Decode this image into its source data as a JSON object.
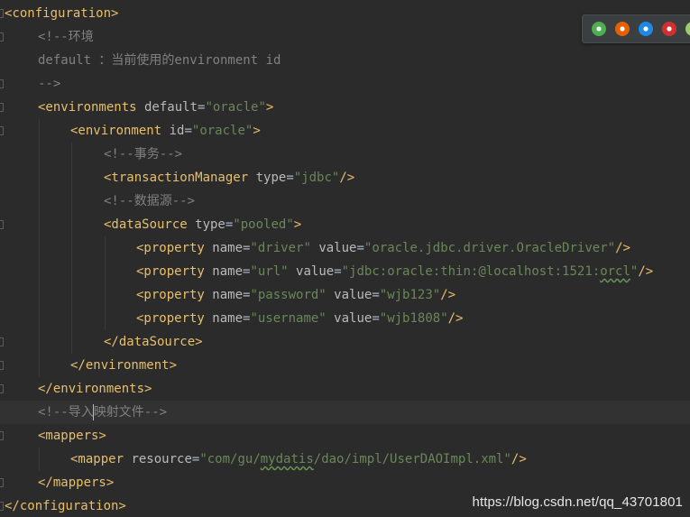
{
  "editor": {
    "lines": [
      [
        {
          "t": "<",
          "c": "tag"
        },
        {
          "t": "configuration",
          "c": "tag"
        },
        {
          "t": ">",
          "c": "tag"
        }
      ],
      [
        {
          "t": "<!--环境",
          "c": "cmt"
        }
      ],
      [
        {
          "t": "default ：当前使用的environment id",
          "c": "cmt"
        }
      ],
      [
        {
          "t": "-->",
          "c": "cmt"
        }
      ],
      [
        {
          "t": "<environments",
          "c": "tag"
        },
        {
          "t": " default",
          "c": "attr"
        },
        {
          "t": "=",
          "c": "txt"
        },
        {
          "t": "\"oracle\"",
          "c": "str"
        },
        {
          "t": ">",
          "c": "tag"
        }
      ],
      [
        {
          "t": "<environment",
          "c": "tag"
        },
        {
          "t": " id",
          "c": "attr"
        },
        {
          "t": "=",
          "c": "txt"
        },
        {
          "t": "\"oracle\"",
          "c": "str"
        },
        {
          "t": ">",
          "c": "tag"
        }
      ],
      [
        {
          "t": "<!--事务-->",
          "c": "cmt"
        }
      ],
      [
        {
          "t": "<transactionManager",
          "c": "tag"
        },
        {
          "t": " type",
          "c": "attr"
        },
        {
          "t": "=",
          "c": "txt"
        },
        {
          "t": "\"jdbc\"",
          "c": "str"
        },
        {
          "t": "/>",
          "c": "tag"
        }
      ],
      [
        {
          "t": "<!--数据源-->",
          "c": "cmt"
        }
      ],
      [
        {
          "t": "<dataSource",
          "c": "tag"
        },
        {
          "t": " type",
          "c": "attr"
        },
        {
          "t": "=",
          "c": "txt"
        },
        {
          "t": "\"pooled\"",
          "c": "str"
        },
        {
          "t": ">",
          "c": "tag"
        }
      ],
      [
        {
          "t": "<property",
          "c": "tag"
        },
        {
          "t": " name",
          "c": "attr"
        },
        {
          "t": "=",
          "c": "txt"
        },
        {
          "t": "\"driver\"",
          "c": "str"
        },
        {
          "t": " value",
          "c": "attr"
        },
        {
          "t": "=",
          "c": "txt"
        },
        {
          "t": "\"oracle.jdbc.driver.OracleDriver\"",
          "c": "str"
        },
        {
          "t": "/>",
          "c": "tag"
        }
      ],
      [
        {
          "t": "<property",
          "c": "tag"
        },
        {
          "t": " name",
          "c": "attr"
        },
        {
          "t": "=",
          "c": "txt"
        },
        {
          "t": "\"url\"",
          "c": "str"
        },
        {
          "t": " value",
          "c": "attr"
        },
        {
          "t": "=",
          "c": "txt"
        },
        {
          "t": "\"jdbc:oracle:thin:@localhost:1521:",
          "c": "str"
        },
        {
          "t": "orcl",
          "c": "str typo"
        },
        {
          "t": "\"",
          "c": "str"
        },
        {
          "t": "/>",
          "c": "tag"
        }
      ],
      [
        {
          "t": "<property",
          "c": "tag"
        },
        {
          "t": " name",
          "c": "attr"
        },
        {
          "t": "=",
          "c": "txt"
        },
        {
          "t": "\"password\"",
          "c": "str"
        },
        {
          "t": " value",
          "c": "attr"
        },
        {
          "t": "=",
          "c": "txt"
        },
        {
          "t": "\"wjb123\"",
          "c": "str"
        },
        {
          "t": "/>",
          "c": "tag"
        }
      ],
      [
        {
          "t": "<property",
          "c": "tag"
        },
        {
          "t": " name",
          "c": "attr"
        },
        {
          "t": "=",
          "c": "txt"
        },
        {
          "t": "\"username\"",
          "c": "str"
        },
        {
          "t": " value",
          "c": "attr"
        },
        {
          "t": "=",
          "c": "txt"
        },
        {
          "t": "\"wjb1808\"",
          "c": "str"
        },
        {
          "t": "/>",
          "c": "tag"
        }
      ],
      [
        {
          "t": "</dataSource>",
          "c": "tag"
        }
      ],
      [
        {
          "t": "</environment>",
          "c": "tag"
        }
      ],
      [
        {
          "t": "</environments>",
          "c": "tag"
        }
      ],
      [
        {
          "t": "<!--导入",
          "c": "cmt"
        },
        {
          "t": "",
          "c": "caret"
        },
        {
          "t": "映射文件-->",
          "c": "cmt"
        }
      ],
      [
        {
          "t": "<mappers>",
          "c": "tag"
        }
      ],
      [
        {
          "t": "<mapper",
          "c": "tag"
        },
        {
          "t": " resource",
          "c": "attr"
        },
        {
          "t": "=",
          "c": "txt"
        },
        {
          "t": "\"com/gu/",
          "c": "str"
        },
        {
          "t": "mydatis",
          "c": "str typo"
        },
        {
          "t": "/dao/impl/UserDAOImpl.xml\"",
          "c": "str"
        },
        {
          "t": "/>",
          "c": "tag"
        }
      ],
      [
        {
          "t": "</mappers>",
          "c": "tag"
        }
      ],
      [
        {
          "t": "</configuration>",
          "c": "tag"
        }
      ]
    ]
  },
  "browser_icons": [
    {
      "name": "chrome-icon",
      "color": "#4caf50"
    },
    {
      "name": "firefox-icon",
      "color": "#e66000"
    },
    {
      "name": "safari-icon",
      "color": "#1e88e5"
    },
    {
      "name": "opera-icon",
      "color": "#d32f2f"
    },
    {
      "name": "ie-icon",
      "color": "#9ccc65"
    }
  ],
  "watermark": "https://blog.csdn.net/qq_43701801"
}
